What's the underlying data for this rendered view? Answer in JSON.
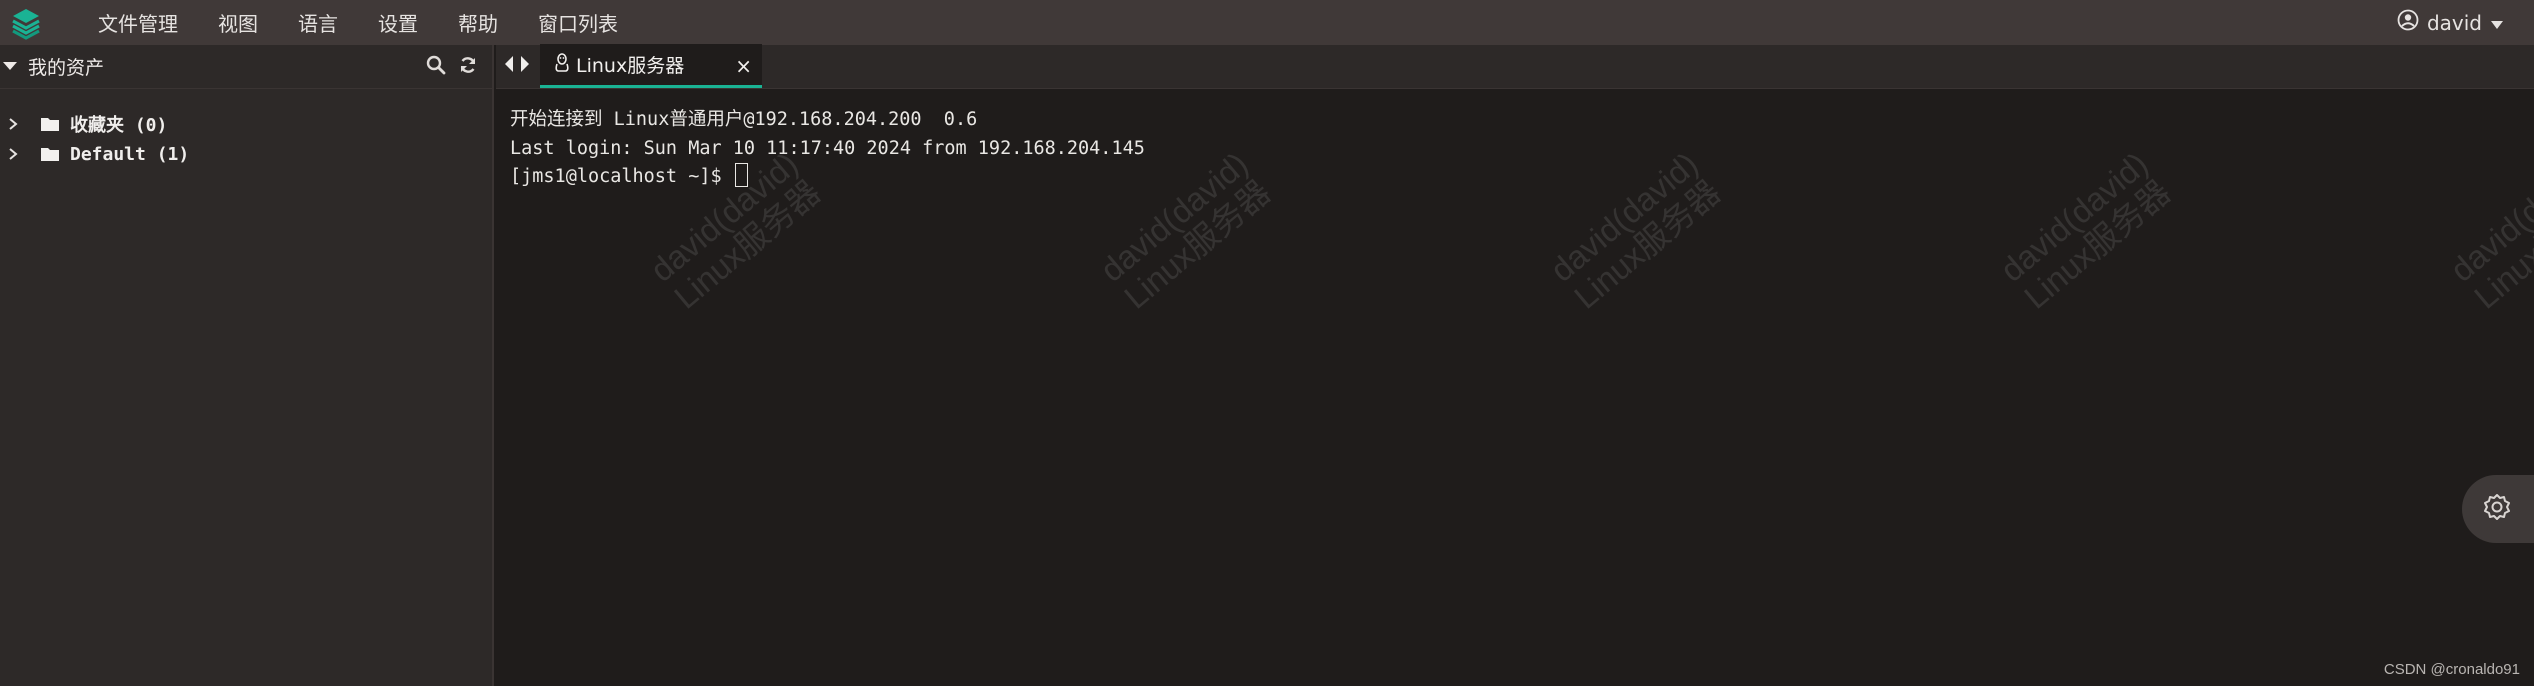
{
  "menubar": {
    "items": [
      "文件管理",
      "视图",
      "语言",
      "设置",
      "帮助",
      "窗口列表"
    ],
    "user": "david"
  },
  "sidebar": {
    "title": "我的资产",
    "tree": [
      {
        "label": "收藏夹 (0)"
      },
      {
        "label": "Default (1)"
      }
    ]
  },
  "tabs": [
    {
      "label": "Linux服务器",
      "close": "×"
    }
  ],
  "terminal": {
    "lines": [
      "开始连接到 Linux普通用户@192.168.204.200  0.6",
      "Last login: Sun Mar 10 11:17:40 2024 from 192.168.204.145",
      "[jms1@localhost ~]$ "
    ],
    "watermark": [
      "david(david)",
      "Linux服务器"
    ]
  },
  "footer": {
    "credit": "CSDN @cronaldo91"
  },
  "colors": {
    "accent": "#1ab394",
    "menubar": "#403938",
    "sidebar": "#2d2928",
    "terminal_bg": "#1f1c1b"
  },
  "icons": {
    "logo": "jumpserver-logo-icon",
    "user": "user-circle-icon",
    "search": "search-icon",
    "refresh": "refresh-icon",
    "tab": "linux-penguin-icon",
    "settings": "gear-icon"
  }
}
